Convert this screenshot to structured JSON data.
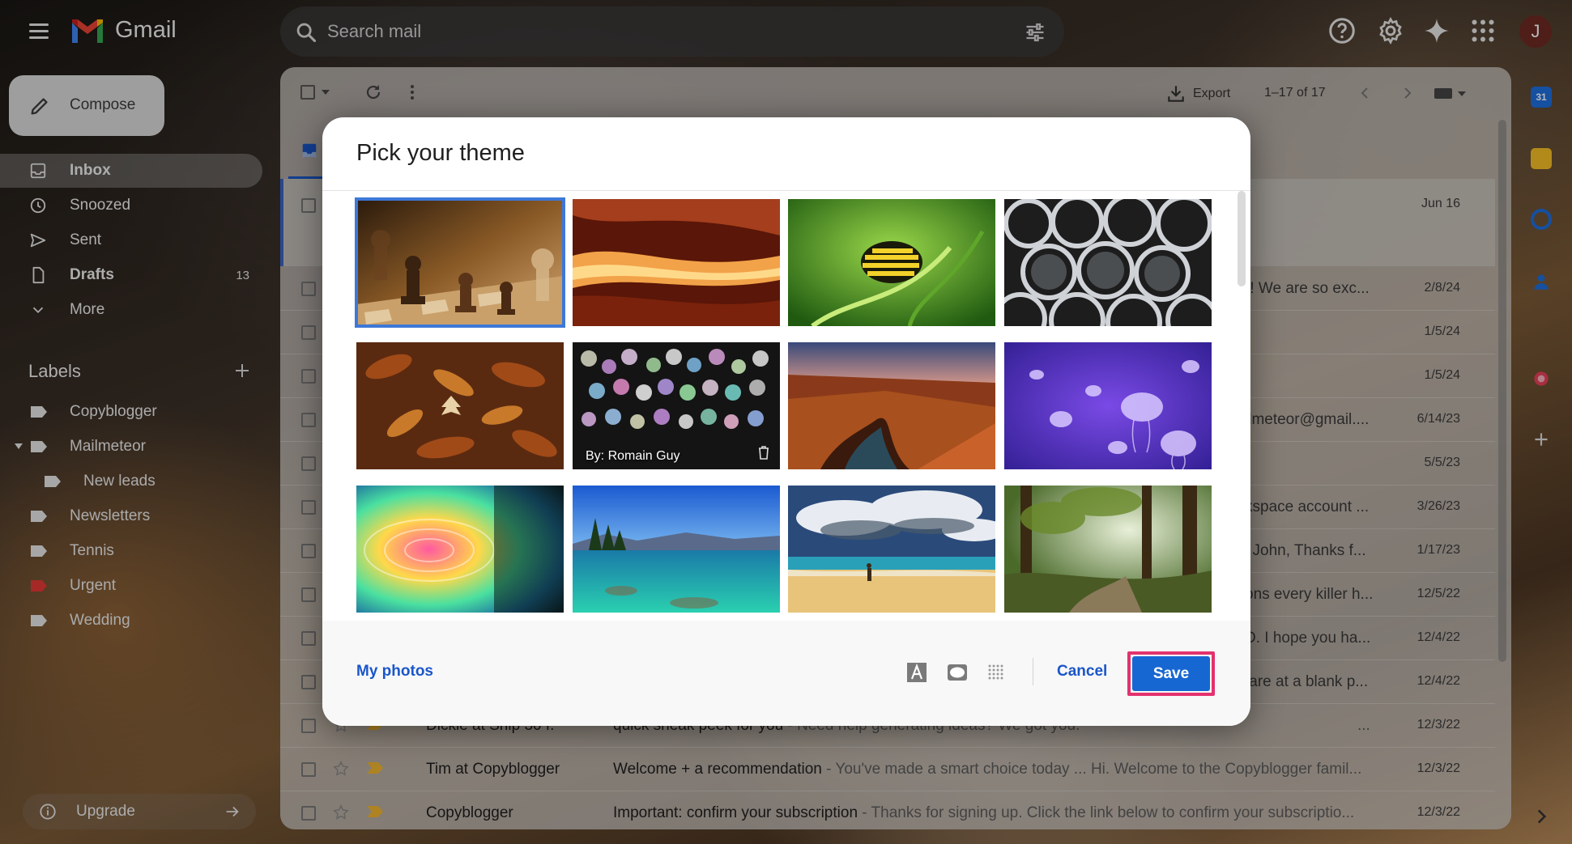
{
  "app": {
    "name": "Gmail",
    "avatar_initial": "J"
  },
  "search": {
    "placeholder": "Search mail"
  },
  "compose": {
    "label": "Compose"
  },
  "nav": [
    {
      "label": "Inbox",
      "icon": "inbox-icon",
      "count": "",
      "active": true,
      "bold": true
    },
    {
      "label": "Snoozed",
      "icon": "clock-icon",
      "count": "",
      "active": false,
      "bold": false
    },
    {
      "label": "Sent",
      "icon": "send-icon",
      "count": "",
      "active": false,
      "bold": false
    },
    {
      "label": "Drafts",
      "icon": "draft-icon",
      "count": "13",
      "active": false,
      "bold": true
    },
    {
      "label": "More",
      "icon": "chevron-down-icon",
      "count": "",
      "active": false,
      "bold": false
    }
  ],
  "labels": {
    "title": "Labels",
    "items": [
      {
        "label": "Copyblogger",
        "color": "#e8e8e8"
      },
      {
        "label": "Mailmeteor",
        "color": "#e8e8e8"
      },
      {
        "label": "New leads",
        "color": "#e8e8e8"
      },
      {
        "label": "Newsletters",
        "color": "#e8e8e8"
      },
      {
        "label": "Tennis",
        "color": "#e8e8e8"
      },
      {
        "label": "Urgent",
        "color": "#e53935"
      },
      {
        "label": "Wedding",
        "color": "#e8e8e8"
      }
    ]
  },
  "upgrade": {
    "label": "Upgrade"
  },
  "toolbar": {
    "export_label": "Export",
    "pager": "1–17 of 17"
  },
  "emails": {
    "first_date": "Jun 16",
    "rows": [
      {
        "snippet": "r! We are so exc...",
        "date": "2/8/24"
      },
      {
        "snippet": "",
        "date": "1/5/24"
      },
      {
        "snippet": "",
        "date": "1/5/24"
      },
      {
        "snippet": "ilmeteor@gmail....",
        "date": "6/14/23"
      },
      {
        "snippet": "",
        "date": "5/5/23"
      },
      {
        "snippet": "kspace account ...",
        "date": "3/26/23"
      },
      {
        "snippet": "i John, Thanks f...",
        "date": "1/17/23"
      },
      {
        "snippet": "ons every killer h...",
        "date": "12/5/22"
      },
      {
        "snippet": "D. I hope you ha...",
        "date": "12/4/22"
      },
      {
        "snippet": "tare at a blank p...",
        "date": "12/4/22"
      }
    ],
    "full_rows": [
      {
        "sender": "Dickie at Ship 30 f.",
        "subject": "quick sneak peek for you",
        "snippet": " - Need help generating ideas? We got you.",
        "trail": "...",
        "date": "12/3/22"
      },
      {
        "sender": "Tim at Copyblogger",
        "subject": "Welcome + a recommendation",
        "snippet": " - You've made a smart choice today ... Hi. Welcome to the Copyblogger famil...",
        "trail": "",
        "date": "12/3/22"
      },
      {
        "sender": "Copyblogger",
        "subject": "Important: confirm your subscription",
        "snippet": " - Thanks for signing up. Click the link below to confirm your subscriptio...",
        "trail": "",
        "date": "12/3/22"
      }
    ]
  },
  "modal": {
    "title": "Pick your theme",
    "themes": [
      {
        "name": "chess",
        "selected": true,
        "caption": ""
      },
      {
        "name": "canyon-rock",
        "selected": false,
        "caption": ""
      },
      {
        "name": "caterpillar",
        "selected": false,
        "caption": ""
      },
      {
        "name": "metal-pipes",
        "selected": false,
        "caption": ""
      },
      {
        "name": "autumn-leaves",
        "selected": false,
        "caption": ""
      },
      {
        "name": "bokeh-lights",
        "selected": false,
        "caption": "By: Romain Guy"
      },
      {
        "name": "grand-canyon",
        "selected": false,
        "caption": ""
      },
      {
        "name": "jellyfish",
        "selected": false,
        "caption": ""
      },
      {
        "name": "rainbow-water",
        "selected": false,
        "caption": ""
      },
      {
        "name": "lake-tahoe",
        "selected": false,
        "caption": ""
      },
      {
        "name": "beach",
        "selected": false,
        "caption": ""
      },
      {
        "name": "forest",
        "selected": false,
        "caption": ""
      }
    ],
    "my_photos_label": "My photos",
    "cancel_label": "Cancel",
    "save_label": "Save"
  }
}
